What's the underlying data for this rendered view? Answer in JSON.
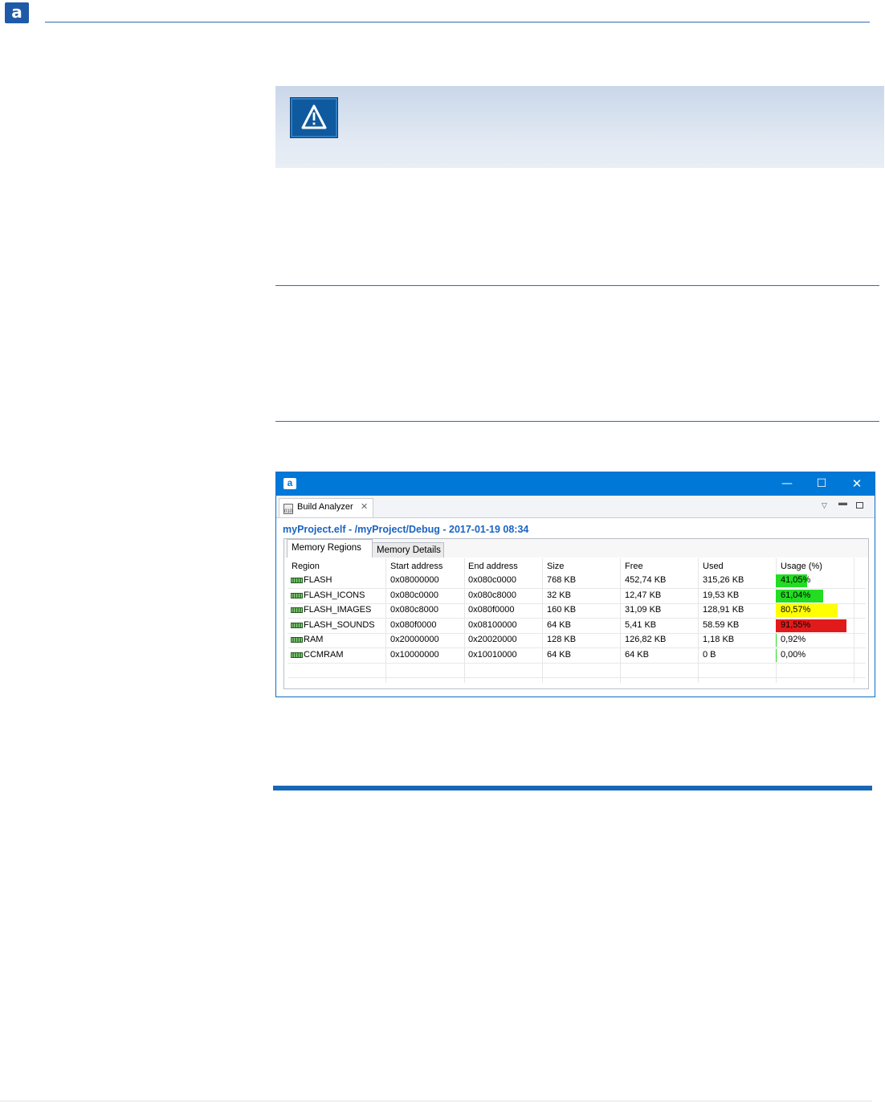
{
  "document": {
    "logo_text": "a"
  },
  "window": {
    "app_icon_text": "a",
    "controls": {
      "minimize": "—",
      "maximize": "☐",
      "close": "✕"
    },
    "view_tab": {
      "label": "Build Analyzer",
      "icon_text": "010",
      "close": "✕"
    },
    "file_title": "myProject.elf - /myProject/Debug - 2017-01-19 08:34",
    "subtabs": [
      "Memory Regions",
      "Memory Details"
    ],
    "columns": [
      "Region",
      "Start address",
      "End address",
      "Size",
      "Free",
      "Used",
      "Usage (%)"
    ],
    "rows": [
      {
        "region": "FLASH",
        "start": "0x08000000",
        "end": "0x080c0000",
        "size": "768 KB",
        "free": "452,74 KB",
        "used": "315,26 KB",
        "usage": "41,05%",
        "usage_value": 41.05,
        "bar_color": "#22dd22"
      },
      {
        "region": "FLASH_ICONS",
        "start": "0x080c0000",
        "end": "0x080c8000",
        "size": "32 KB",
        "free": "12,47 KB",
        "used": "19,53 KB",
        "usage": "61,04%",
        "usage_value": 61.04,
        "bar_color": "#22dd22"
      },
      {
        "region": "FLASH_IMAGES",
        "start": "0x080c8000",
        "end": "0x080f0000",
        "size": "160 KB",
        "free": "31,09 KB",
        "used": "128,91 KB",
        "usage": "80,57%",
        "usage_value": 80.57,
        "bar_color": "#ffff00"
      },
      {
        "region": "FLASH_SOUNDS",
        "start": "0x080f0000",
        "end": "0x08100000",
        "size": "64 KB",
        "free": "5,41 KB",
        "used": "58.59 KB",
        "usage": "91,55%",
        "usage_value": 91.55,
        "bar_color": "#e11b1b"
      },
      {
        "region": "RAM",
        "start": "0x20000000",
        "end": "0x20020000",
        "size": "128 KB",
        "free": "126,82 KB",
        "used": "1,18 KB",
        "usage": "0,92%",
        "usage_value": 0.92,
        "bar_color": "#22dd22"
      },
      {
        "region": "CCMRAM",
        "start": "0x10000000",
        "end": "0x10010000",
        "size": "64 KB",
        "free": "64 KB",
        "used": "0 B",
        "usage": "0,00%",
        "usage_value": 0.0,
        "bar_color": "#22dd22"
      }
    ]
  }
}
